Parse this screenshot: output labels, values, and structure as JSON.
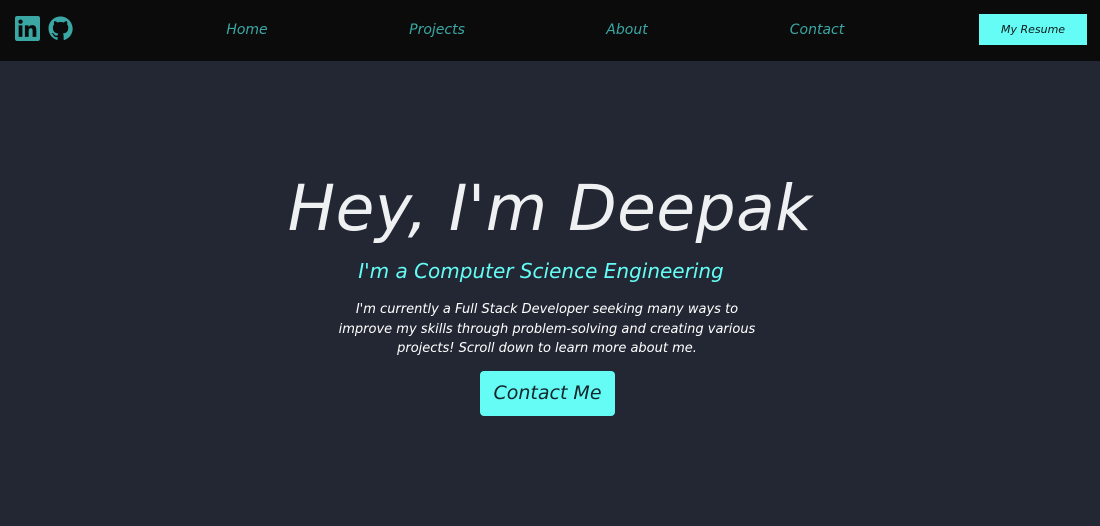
{
  "navbar": {
    "social": [
      {
        "name": "linkedin",
        "icon": "linkedin-icon"
      },
      {
        "name": "github",
        "icon": "github-icon"
      }
    ],
    "links": [
      "Home",
      "Projects",
      "About",
      "Contact"
    ],
    "resume_label": "My Resume"
  },
  "hero": {
    "title": "Hey, I'm Deepak",
    "subtitle": "I'm a Computer Science Engineering",
    "description_lines": [
      "I'm currently a Full Stack Developer seeking many ways to",
      "improve my skills through problem-solving and creating various",
      "projects! Scroll down to learn more about me."
    ],
    "contact_label": "Contact Me"
  },
  "colors": {
    "navbar_bg": "#0b0b0b",
    "page_bg": "#222733",
    "accent": "#64fcf4",
    "nav_link": "#3aa7a4",
    "title_text": "#eef0f2"
  }
}
